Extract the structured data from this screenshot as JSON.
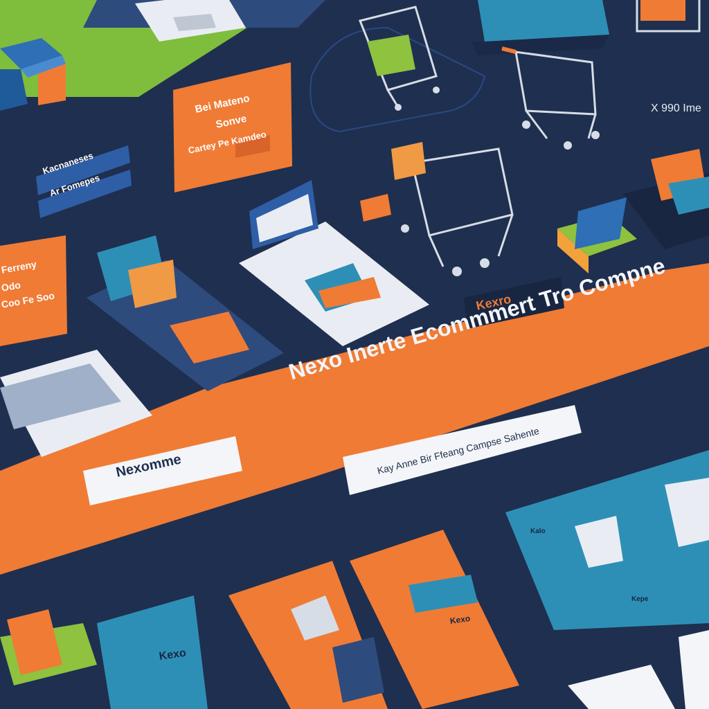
{
  "banner": {
    "headline": "Nexo Inerte Ecommmert Tro Compne",
    "left_pill": "Nexomme",
    "right_pill": "Kay Anne Bir Ffeang Campse Sahente",
    "badge": "Kexro"
  },
  "cards": {
    "top_orange_lines": [
      "Bei Mateno",
      "Sonve",
      "Cartey Pe Kamdeo"
    ],
    "left_orange_lines": [
      "Ferreny",
      "Odo",
      "Coo Fe Soo"
    ],
    "pill_left_1": "Kacnaneses",
    "pill_left_2": "Ar Fomepes",
    "right_logo": "X 990 Ime",
    "bottom_left_logo": "Kexo",
    "bottom_teal_caption": "Kalo",
    "bottom_teal_caption2": "Kepe",
    "bottom_orange_label": "Kexo"
  },
  "colors": {
    "navy": "#1f2f4f",
    "navy_dark": "#182642",
    "orange": "#f07b35",
    "teal": "#2e8fb6",
    "green": "#7fbd3c",
    "white": "#f3f5f8"
  }
}
